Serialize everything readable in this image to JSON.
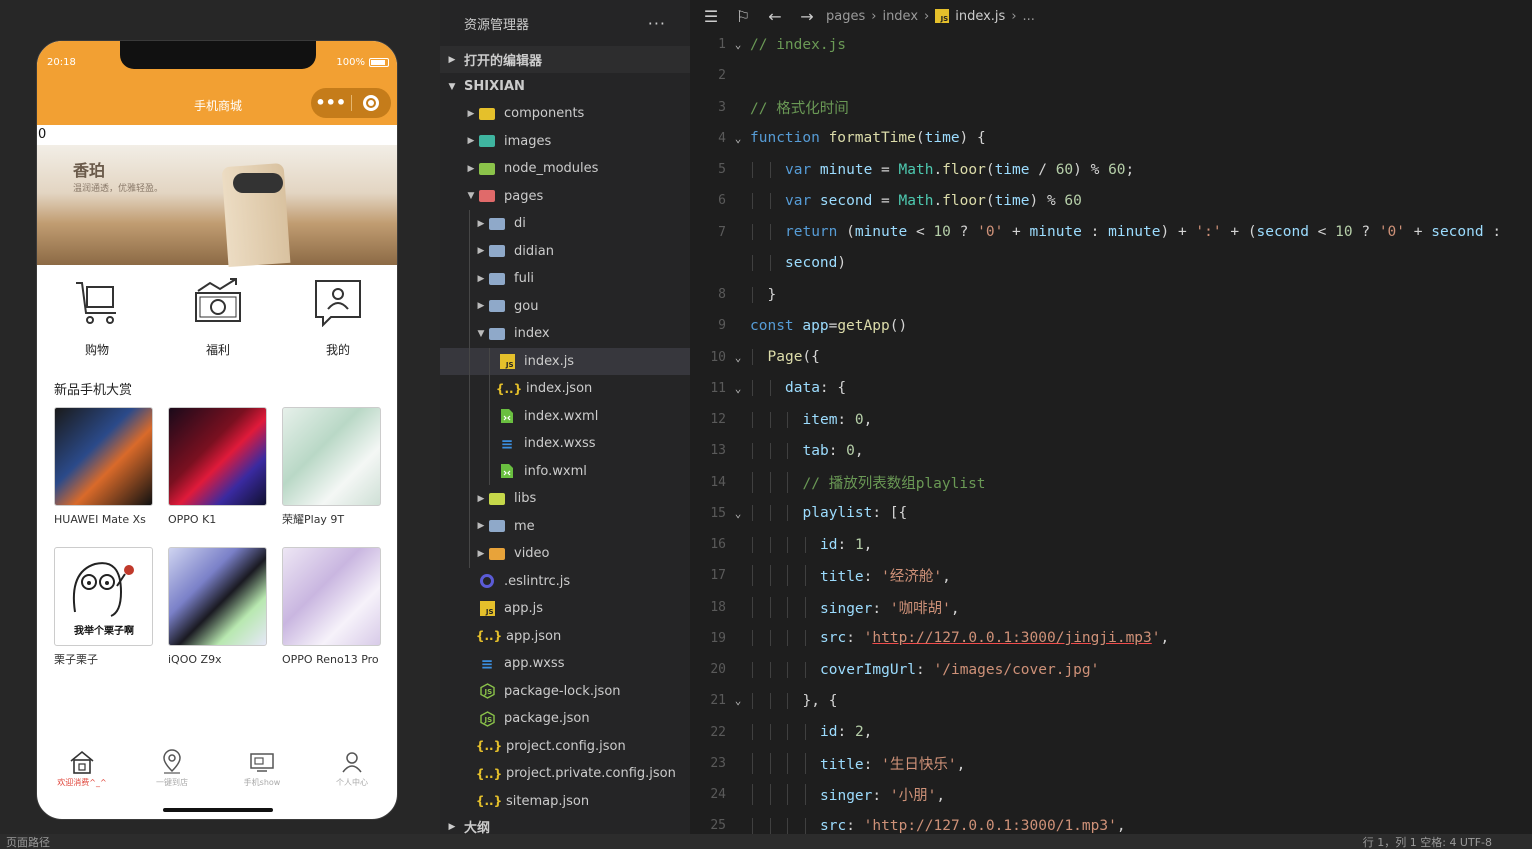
{
  "phone": {
    "time": "20:18",
    "battery": "100%",
    "nav_title": "手机商城",
    "capsule_menu": "•••",
    "counter": "0",
    "banner_title": "香珀",
    "banner_sub": "温润通透，优雅轻盈。",
    "shortcuts": [
      {
        "label": "购物",
        "icon": "cart-icon"
      },
      {
        "label": "福利",
        "icon": "money-icon"
      },
      {
        "label": "我的",
        "icon": "profile-card-icon"
      }
    ],
    "section_title": "新品手机大赏",
    "products": [
      {
        "name": "HUAWEI Mate Xs"
      },
      {
        "name": "OPPO K1"
      },
      {
        "name": "荣耀Play 9T"
      },
      {
        "name": "栗子栗子"
      },
      {
        "name": "iQOO Z9x"
      },
      {
        "name": "OPPO Reno13 Pro"
      }
    ],
    "sticker_text": "我举个栗子啊",
    "tabs": [
      {
        "label": "欢迎消费^_^",
        "icon": "home-icon",
        "active": true
      },
      {
        "label": "一键到店",
        "icon": "location-pin-icon",
        "active": false
      },
      {
        "label": "手机show",
        "icon": "tv-icon",
        "active": false
      },
      {
        "label": "个人中心",
        "icon": "person-icon",
        "active": false
      }
    ],
    "accent": "#f2a033"
  },
  "explorer": {
    "title": "资源管理器",
    "more": "···",
    "open_editors": "打开的编辑器",
    "project": "SHIXIAN",
    "outline": "大纲",
    "tree": [
      {
        "name": "components",
        "kind": "folder-components",
        "depth": 1,
        "caret": "▶"
      },
      {
        "name": "images",
        "kind": "folder-images",
        "depth": 1,
        "caret": "▶"
      },
      {
        "name": "node_modules",
        "kind": "folder-node",
        "depth": 1,
        "caret": "▶"
      },
      {
        "name": "pages",
        "kind": "folder-pages",
        "depth": 1,
        "caret": "▼"
      },
      {
        "name": "di",
        "kind": "folder",
        "depth": 2,
        "caret": "▶"
      },
      {
        "name": "didian",
        "kind": "folder",
        "depth": 2,
        "caret": "▶"
      },
      {
        "name": "fuli",
        "kind": "folder",
        "depth": 2,
        "caret": "▶"
      },
      {
        "name": "gou",
        "kind": "folder",
        "depth": 2,
        "caret": "▶"
      },
      {
        "name": "index",
        "kind": "folder-open",
        "depth": 2,
        "caret": "▼"
      },
      {
        "name": "index.js",
        "kind": "js",
        "depth": 3,
        "caret": "",
        "selected": true
      },
      {
        "name": "index.json",
        "kind": "json",
        "depth": 3,
        "caret": ""
      },
      {
        "name": "index.wxml",
        "kind": "wxml",
        "depth": 3,
        "caret": ""
      },
      {
        "name": "index.wxss",
        "kind": "wxss",
        "depth": 3,
        "caret": ""
      },
      {
        "name": "info.wxml",
        "kind": "wxml",
        "depth": 3,
        "caret": ""
      },
      {
        "name": "libs",
        "kind": "folder-libs",
        "depth": 2,
        "caret": "▶"
      },
      {
        "name": "me",
        "kind": "folder",
        "depth": 2,
        "caret": "▶"
      },
      {
        "name": "video",
        "kind": "folder-video",
        "depth": 2,
        "caret": "▶"
      },
      {
        "name": ".eslintrc.js",
        "kind": "eslint",
        "depth": 1,
        "caret": ""
      },
      {
        "name": "app.js",
        "kind": "js",
        "depth": 1,
        "caret": ""
      },
      {
        "name": "app.json",
        "kind": "json",
        "depth": 1,
        "caret": ""
      },
      {
        "name": "app.wxss",
        "kind": "wxss",
        "depth": 1,
        "caret": ""
      },
      {
        "name": "package-lock.json",
        "kind": "node",
        "depth": 1,
        "caret": ""
      },
      {
        "name": "package.json",
        "kind": "node",
        "depth": 1,
        "caret": ""
      },
      {
        "name": "project.config.json",
        "kind": "json",
        "depth": 1,
        "caret": ""
      },
      {
        "name": "project.private.config.json",
        "kind": "json",
        "depth": 1,
        "caret": ""
      },
      {
        "name": "sitemap.json",
        "kind": "json",
        "depth": 1,
        "caret": ""
      }
    ]
  },
  "editor": {
    "breadcrumb": [
      "pages",
      "index",
      "index.js",
      "..."
    ],
    "lines": [
      {
        "n": "1",
        "fold": "⌄",
        "indent": 0,
        "tokens": [
          [
            "cm",
            "// index.js"
          ]
        ]
      },
      {
        "n": "2",
        "fold": "",
        "indent": 0,
        "tokens": []
      },
      {
        "n": "3",
        "fold": "",
        "indent": 0,
        "tokens": [
          [
            "cm",
            "// 格式化时间"
          ]
        ]
      },
      {
        "n": "4",
        "fold": "⌄",
        "indent": 0,
        "tokens": [
          [
            "kw",
            "function "
          ],
          [
            "fn",
            "formatTime"
          ],
          [
            "txt",
            "("
          ],
          [
            "id",
            "time"
          ],
          [
            "txt",
            ") {"
          ]
        ]
      },
      {
        "n": "5",
        "fold": "",
        "indent": 2,
        "tokens": [
          [
            "kw",
            "var "
          ],
          [
            "id",
            "minute"
          ],
          [
            "txt",
            " = "
          ],
          [
            "cl",
            "Math"
          ],
          [
            "txt",
            "."
          ],
          [
            "fn",
            "floor"
          ],
          [
            "txt",
            "("
          ],
          [
            "id",
            "time"
          ],
          [
            "txt",
            " / "
          ],
          [
            "nm",
            "60"
          ],
          [
            "txt",
            ") % "
          ],
          [
            "nm",
            "60"
          ],
          [
            "txt",
            ";"
          ]
        ]
      },
      {
        "n": "6",
        "fold": "",
        "indent": 2,
        "tokens": [
          [
            "kw",
            "var "
          ],
          [
            "id",
            "second"
          ],
          [
            "txt",
            " = "
          ],
          [
            "cl",
            "Math"
          ],
          [
            "txt",
            "."
          ],
          [
            "fn",
            "floor"
          ],
          [
            "txt",
            "("
          ],
          [
            "id",
            "time"
          ],
          [
            "txt",
            ") % "
          ],
          [
            "nm",
            "60"
          ]
        ]
      },
      {
        "n": "7",
        "fold": "",
        "indent": 2,
        "tokens": [
          [
            "kw",
            "return "
          ],
          [
            "txt",
            "("
          ],
          [
            "id",
            "minute"
          ],
          [
            "txt",
            " < "
          ],
          [
            "nm",
            "10"
          ],
          [
            "txt",
            " ? "
          ],
          [
            "st",
            "'0'"
          ],
          [
            "txt",
            " + "
          ],
          [
            "id",
            "minute"
          ],
          [
            "txt",
            " : "
          ],
          [
            "id",
            "minute"
          ],
          [
            "txt",
            ") + "
          ],
          [
            "st",
            "':'"
          ],
          [
            "txt",
            " + ("
          ],
          [
            "id",
            "second"
          ],
          [
            "txt",
            " < "
          ],
          [
            "nm",
            "10"
          ],
          [
            "txt",
            " ? "
          ],
          [
            "st",
            "'0'"
          ],
          [
            "txt",
            " + "
          ],
          [
            "id",
            "second"
          ],
          [
            "txt",
            " :"
          ]
        ]
      },
      {
        "n": "",
        "fold": "",
        "indent": 2,
        "tokens": [
          [
            "id",
            "second"
          ],
          [
            "txt",
            ")"
          ]
        ]
      },
      {
        "n": "8",
        "fold": "",
        "indent": 1,
        "tokens": [
          [
            "txt",
            "}"
          ]
        ]
      },
      {
        "n": "9",
        "fold": "",
        "indent": 0,
        "tokens": [
          [
            "kw",
            "const "
          ],
          [
            "id",
            "app"
          ],
          [
            "txt",
            "="
          ],
          [
            "fn",
            "getApp"
          ],
          [
            "txt",
            "()"
          ]
        ]
      },
      {
        "n": "10",
        "fold": "⌄",
        "indent": 1,
        "tokens": [
          [
            "fn",
            "Page"
          ],
          [
            "txt",
            "({"
          ]
        ]
      },
      {
        "n": "11",
        "fold": "⌄",
        "indent": 2,
        "tokens": [
          [
            "id",
            "data"
          ],
          [
            "txt",
            ": {"
          ]
        ]
      },
      {
        "n": "12",
        "fold": "",
        "indent": 3,
        "tokens": [
          [
            "id",
            "item"
          ],
          [
            "txt",
            ": "
          ],
          [
            "nm",
            "0"
          ],
          [
            "txt",
            ","
          ]
        ]
      },
      {
        "n": "13",
        "fold": "",
        "indent": 3,
        "tokens": [
          [
            "id",
            "tab"
          ],
          [
            "txt",
            ": "
          ],
          [
            "nm",
            "0"
          ],
          [
            "txt",
            ","
          ]
        ]
      },
      {
        "n": "14",
        "fold": "",
        "indent": 3,
        "tokens": [
          [
            "cm",
            "// 播放列表数组playlist"
          ]
        ]
      },
      {
        "n": "15",
        "fold": "⌄",
        "indent": 3,
        "tokens": [
          [
            "id",
            "playlist"
          ],
          [
            "txt",
            ": [{"
          ]
        ]
      },
      {
        "n": "16",
        "fold": "",
        "indent": 4,
        "tokens": [
          [
            "id",
            "id"
          ],
          [
            "txt",
            ": "
          ],
          [
            "nm",
            "1"
          ],
          [
            "txt",
            ","
          ]
        ]
      },
      {
        "n": "17",
        "fold": "",
        "indent": 4,
        "tokens": [
          [
            "id",
            "title"
          ],
          [
            "txt",
            ": "
          ],
          [
            "st",
            "'经济舱'"
          ],
          [
            "txt",
            ","
          ]
        ]
      },
      {
        "n": "18",
        "fold": "",
        "indent": 4,
        "tokens": [
          [
            "id",
            "singer"
          ],
          [
            "txt",
            ": "
          ],
          [
            "st",
            "'咖啡胡'"
          ],
          [
            "txt",
            ","
          ]
        ]
      },
      {
        "n": "19",
        "fold": "",
        "indent": 4,
        "tokens": [
          [
            "id",
            "src"
          ],
          [
            "txt",
            ": "
          ],
          [
            "st",
            "'"
          ],
          [
            "ur",
            "http://127.0.0.1:3000/jingji.mp3"
          ],
          [
            "st",
            "'"
          ],
          [
            "txt",
            ","
          ]
        ]
      },
      {
        "n": "20",
        "fold": "",
        "indent": 4,
        "tokens": [
          [
            "id",
            "coverImgUrl"
          ],
          [
            "txt",
            ": "
          ],
          [
            "st",
            "'/images/cover.jpg'"
          ]
        ]
      },
      {
        "n": "21",
        "fold": "⌄",
        "indent": 3,
        "tokens": [
          [
            "txt",
            "}, {"
          ]
        ]
      },
      {
        "n": "22",
        "fold": "",
        "indent": 4,
        "tokens": [
          [
            "id",
            "id"
          ],
          [
            "txt",
            ": "
          ],
          [
            "nm",
            "2"
          ],
          [
            "txt",
            ","
          ]
        ]
      },
      {
        "n": "23",
        "fold": "",
        "indent": 4,
        "tokens": [
          [
            "id",
            "title"
          ],
          [
            "txt",
            ": "
          ],
          [
            "st",
            "'生日快乐'"
          ],
          [
            "txt",
            ","
          ]
        ]
      },
      {
        "n": "24",
        "fold": "",
        "indent": 4,
        "tokens": [
          [
            "id",
            "singer"
          ],
          [
            "txt",
            ": "
          ],
          [
            "st",
            "'小朋'"
          ],
          [
            "txt",
            ","
          ]
        ]
      },
      {
        "n": "25",
        "fold": "",
        "indent": 4,
        "tokens": [
          [
            "id",
            "src"
          ],
          [
            "txt",
            ": "
          ],
          [
            "st",
            "'http://127.0.0.1:3000/1.mp3'"
          ],
          [
            "txt",
            ","
          ]
        ]
      }
    ]
  },
  "statusbar": {
    "left": "页面路径",
    "right": "行 1，列 1   空格: 4   UTF-8"
  }
}
